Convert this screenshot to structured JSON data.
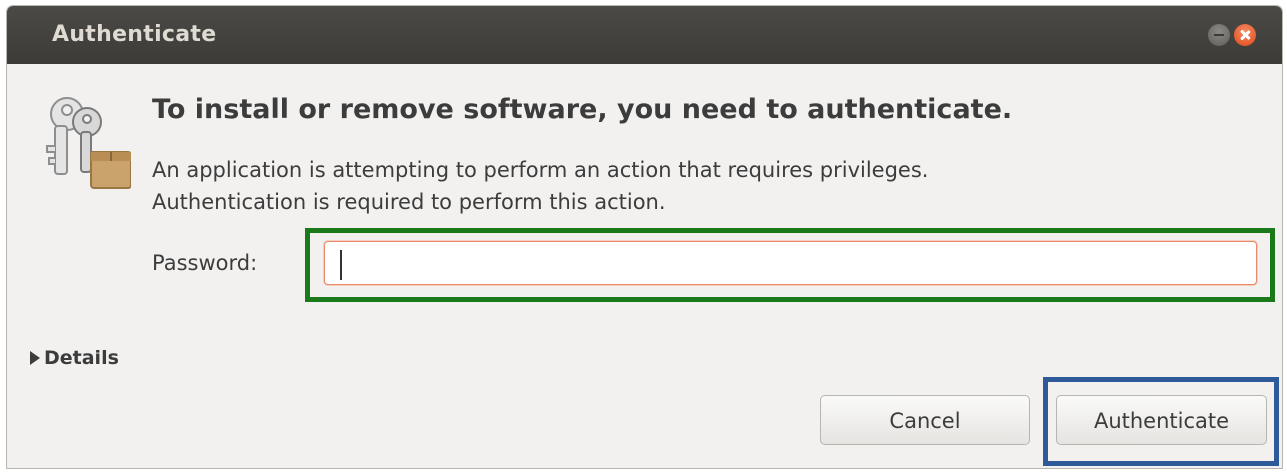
{
  "window": {
    "title": "Authenticate"
  },
  "dialog": {
    "icon": "keys-icon",
    "heading": "To install or remove software, you need to authenticate.",
    "description_line1": "An application is attempting to perform an action that requires privileges.",
    "description_line2": "Authentication is required to perform this action.",
    "password_label": "Password:",
    "password_value": "",
    "details_label": "Details",
    "cancel_label": "Cancel",
    "authenticate_label": "Authenticate"
  },
  "colors": {
    "titlebar": "#3c3b37",
    "close_button": "#df4a16",
    "input_focus_border": "#e88a6a",
    "highlight_green": "#1a7a1a",
    "highlight_blue": "#2e5a9a"
  }
}
